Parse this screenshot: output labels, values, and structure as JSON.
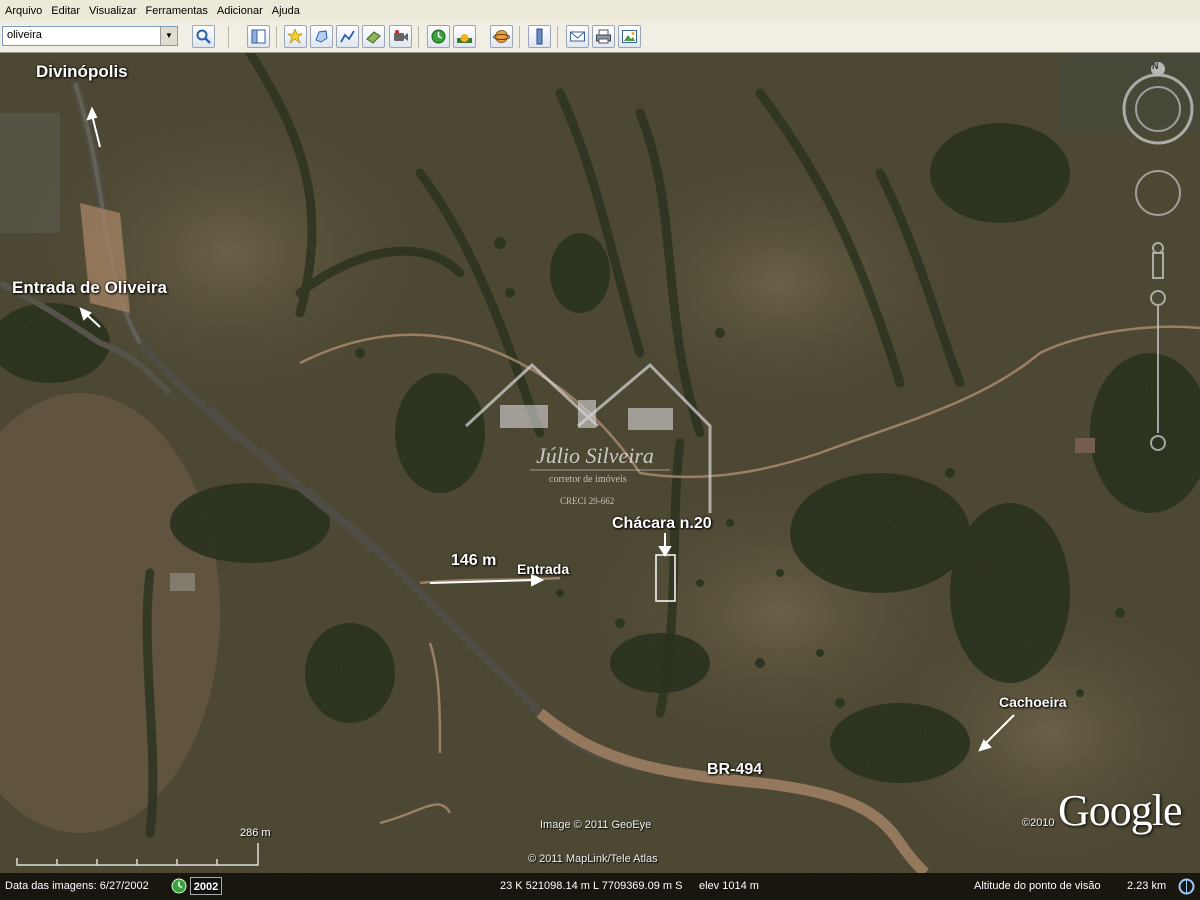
{
  "menu": [
    "Arquivo",
    "Editar",
    "Visualizar",
    "Ferramentas",
    "Adicionar",
    "Ajuda"
  ],
  "search": {
    "value": "oliveira"
  },
  "toolbar_buttons": [
    "search-icon",
    "sidebar-toggle-icon",
    "placemark-icon",
    "polygon-icon",
    "path-icon",
    "image-overlay-icon",
    "record-tour-icon",
    "historical-imagery-icon",
    "sunlight-icon",
    "planet-switch-icon",
    "ruler-icon",
    "email-icon",
    "print-icon",
    "save-image-icon"
  ],
  "map_labels": {
    "divinopolis": "Divinópolis",
    "entrada_oliveira": "Entrada de Oliveira",
    "chacara": "Chácara n.20",
    "distance": "146 m",
    "entrada": "Entrada",
    "cachoeira": "Cachoeira",
    "br494": "BR-494"
  },
  "watermark": {
    "name": "Júlio Silveira",
    "subtitle": "corretor de imóveis",
    "creci": "CRECI 29-662"
  },
  "credits": {
    "geoeye": "Image © 2011 GeoEye",
    "maplink": "© 2011 MapLink/Tele Atlas",
    "google_year": "©2010",
    "google": "Google"
  },
  "scale": {
    "label": "286 m"
  },
  "compass": {
    "north": "N"
  },
  "status": {
    "imagery_date": "Data das imagens: 6/27/2002",
    "year": "2002",
    "coordinates": "23 K 521098.14 m L 7709369.09 m S",
    "elevation": "elev 1014 m",
    "eye_alt_label": "Altitude do ponto de visão",
    "eye_alt_value": "2.23 km"
  },
  "colors": {
    "terrain_base": "#4a4530",
    "forest": "#1f2a17",
    "dirt_road": "#b89478",
    "highway": "#55534c",
    "menu_bg": "#ece9d8"
  }
}
